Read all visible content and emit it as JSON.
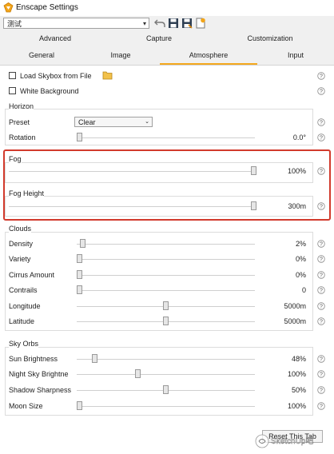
{
  "window": {
    "title": "Enscape Settings"
  },
  "toolbar": {
    "preset": "测试"
  },
  "tabs_top": [
    {
      "label": "Advanced"
    },
    {
      "label": "Capture"
    },
    {
      "label": "Customization"
    }
  ],
  "tabs_bottom": [
    {
      "label": "General"
    },
    {
      "label": "Image"
    },
    {
      "label": "Atmosphere",
      "active": true
    },
    {
      "label": "Input"
    }
  ],
  "options": {
    "load_skybox": "Load Skybox from File",
    "white_background": "White Background"
  },
  "horizon": {
    "title": "Horizon",
    "preset_label": "Preset",
    "preset_value": "Clear",
    "rotation_label": "Rotation",
    "rotation_value": "0.0°",
    "rotation_fraction": 0.0
  },
  "fog": {
    "label": "Fog",
    "value": "100%",
    "fraction": 1.0
  },
  "fog_height": {
    "label": "Fog Height",
    "value": "300m",
    "fraction": 1.0
  },
  "clouds": {
    "title": "Clouds",
    "items": [
      {
        "label": "Density",
        "value": "2%",
        "fraction": 0.02
      },
      {
        "label": "Variety",
        "value": "0%",
        "fraction": 0.0
      },
      {
        "label": "Cirrus Amount",
        "value": "0%",
        "fraction": 0.0
      },
      {
        "label": "Contrails",
        "value": "0",
        "fraction": 0.0
      },
      {
        "label": "Longitude",
        "value": "5000m",
        "fraction": 0.5
      },
      {
        "label": "Latitude",
        "value": "5000m",
        "fraction": 0.5
      }
    ]
  },
  "sky_orbs": {
    "title": "Sky Orbs",
    "items": [
      {
        "label": "Sun Brightness",
        "value": "48%",
        "fraction": 0.09
      },
      {
        "label": "Night Sky Brightne",
        "value": "100%",
        "fraction": 0.34
      },
      {
        "label": "Shadow Sharpness",
        "value": "50%",
        "fraction": 0.5
      },
      {
        "label": "Moon Size",
        "value": "100%",
        "fraction": 0.0
      }
    ]
  },
  "footer": {
    "reset_label": "Reset This Tab"
  },
  "watermark": {
    "text": "SketchUp吧"
  },
  "colors": {
    "accent": "#f4a81d",
    "highlight": "#d23a2c"
  },
  "icons": [
    "enscape-logo-icon",
    "undo-icon",
    "save-icon",
    "save-as-icon",
    "new-preset-icon",
    "folder-icon",
    "help-icon"
  ]
}
